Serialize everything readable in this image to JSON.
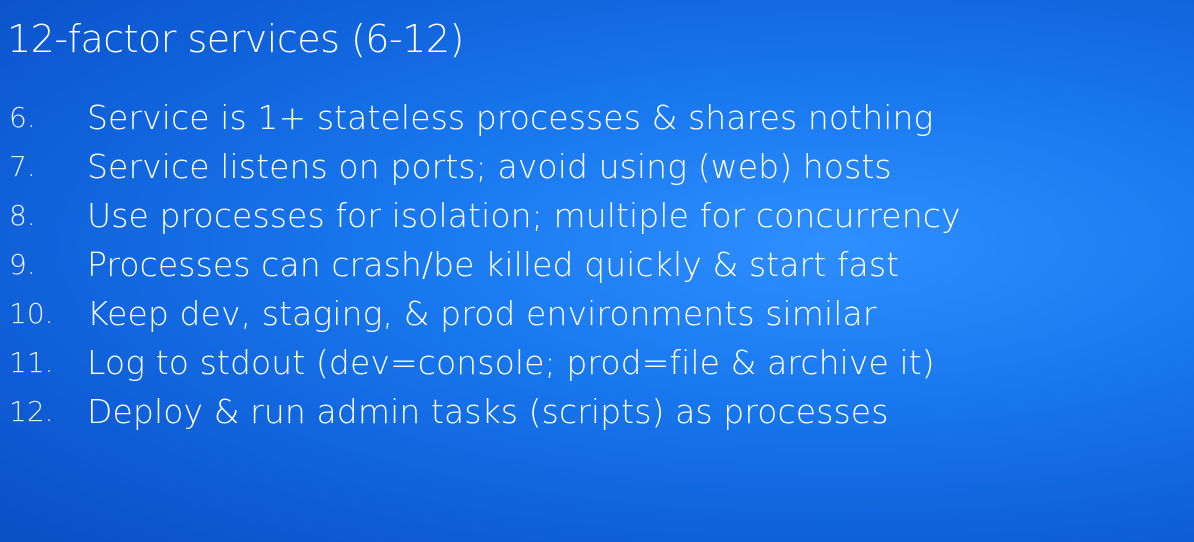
{
  "title": "12-factor services (6-12)",
  "items": [
    {
      "number": "6.",
      "text": "Service is 1+ stateless processes & shares nothing"
    },
    {
      "number": "7.",
      "text": "Service listens on ports; avoid using (web) hosts"
    },
    {
      "number": "8.",
      "text": "Use processes for isolation; multiple for concurrency"
    },
    {
      "number": "9.",
      "text": "Processes can crash/be killed quickly & start fast"
    },
    {
      "number": "10.",
      "text": "Keep dev, staging, & prod environments similar"
    },
    {
      "number": "11.",
      "text": "Log to stdout (dev=console; prod=file & archive it)"
    },
    {
      "number": "12.",
      "text": "Deploy & run admin tasks (scripts) as processes"
    }
  ]
}
